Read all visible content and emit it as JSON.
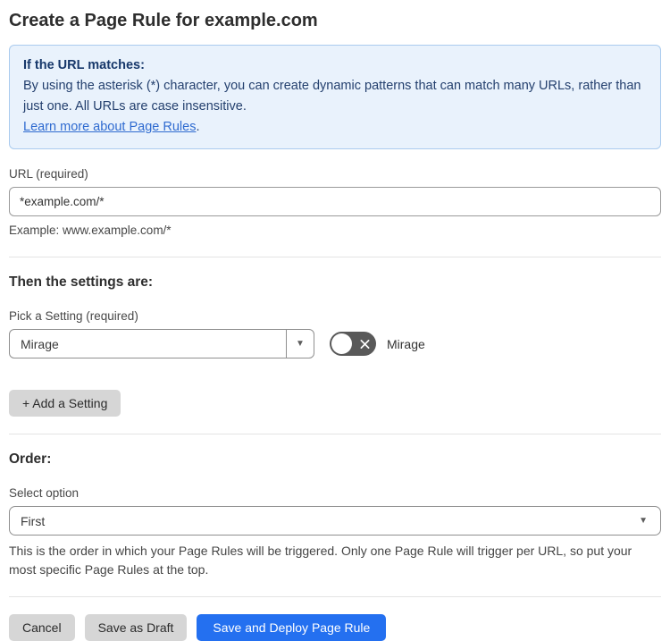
{
  "page": {
    "title": "Create a Page Rule for example.com"
  },
  "info_box": {
    "heading": "If the URL matches:",
    "body": "By using the asterisk (*) character, you can create dynamic patterns that can match many URLs, rather than just one. All URLs are case insensitive.",
    "link_label": "Learn more about Page Rules",
    "link_suffix": "."
  },
  "url_field": {
    "label": "URL (required)",
    "value": "*example.com/*",
    "helper": "Example: www.example.com/*"
  },
  "settings_section": {
    "heading": "Then the settings are:",
    "pick_label": "Pick a Setting (required)",
    "selected_setting": "Mirage",
    "dropdown_arrow": "▼",
    "toggle_state": "off",
    "toggle_label": "Mirage",
    "add_button_label": "+ Add a Setting"
  },
  "order_section": {
    "heading": "Order:",
    "label": "Select option",
    "selected_option": "First",
    "dropdown_arrow": "▼",
    "helper": "This is the order in which your Page Rules will be triggered. Only one Page Rule will trigger per URL, so put your most specific Page Rules at the top."
  },
  "footer": {
    "cancel_label": "Cancel",
    "save_draft_label": "Save as Draft",
    "save_deploy_label": "Save and Deploy Page Rule"
  },
  "colors": {
    "info_background": "#e9f2fc",
    "info_border": "#aacbee",
    "info_text": "#24406e",
    "link_blue": "#2f6bd0",
    "primary_button_blue": "#2470f0",
    "toggle_off_gray": "#595959",
    "secondary_button_gray": "#d6d6d6"
  }
}
